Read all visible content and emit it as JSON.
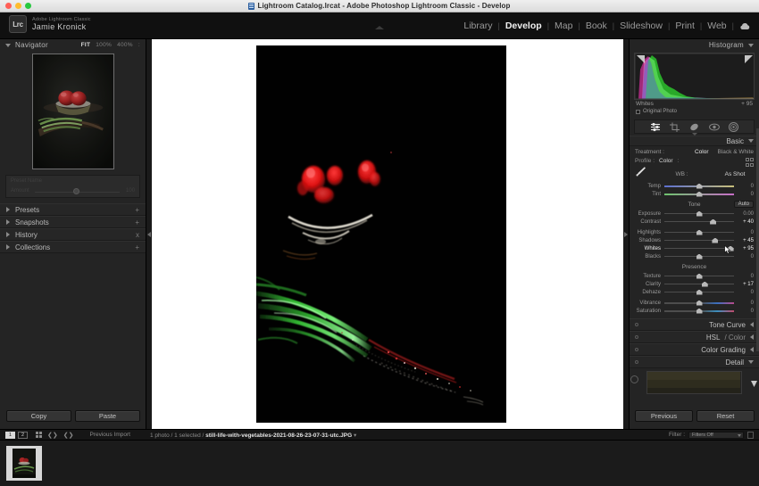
{
  "window": {
    "title": "Lightroom Catalog.lrcat - Adobe Photoshop Lightroom Classic - Develop",
    "doc_icon": "document-icon"
  },
  "brand": {
    "badge": "Lrc",
    "product": "Adobe Lightroom Classic",
    "user": "Jamie Kronick"
  },
  "modules": {
    "items": [
      {
        "label": "Library",
        "active": false
      },
      {
        "label": "Develop",
        "active": true
      },
      {
        "label": "Map",
        "active": false
      },
      {
        "label": "Book",
        "active": false
      },
      {
        "label": "Slideshow",
        "active": false
      },
      {
        "label": "Print",
        "active": false
      },
      {
        "label": "Web",
        "active": false
      }
    ],
    "separator": "|",
    "cloud_icon": "cloud-sync-icon"
  },
  "left_panel": {
    "navigator": {
      "title": "Navigator",
      "zoom_levels": [
        "FIT",
        "100%",
        "400%"
      ],
      "selected_zoom": "FIT",
      "more": ":"
    },
    "preset_preview": {
      "label": "Preset Name",
      "slider_label": "Amount",
      "value": "100"
    },
    "sections": [
      {
        "label": "Presets",
        "action": "+"
      },
      {
        "label": "Snapshots",
        "action": "+"
      },
      {
        "label": "History",
        "action": "x"
      },
      {
        "label": "Collections",
        "action": "+"
      }
    ],
    "buttons": {
      "copy": "Copy",
      "paste": "Paste"
    }
  },
  "right_panel": {
    "histogram": {
      "title": "Histogram",
      "readout_label": "Whites",
      "readout_value": "+ 95",
      "original_photo_label": "Original Photo",
      "original_photo_checked": false
    },
    "tools": [
      {
        "name": "adjustment-brush-icon",
        "active": true
      },
      {
        "name": "crop-overlay-icon",
        "active": false
      },
      {
        "name": "spot-removal-icon",
        "active": false
      },
      {
        "name": "red-eye-icon",
        "active": false
      },
      {
        "name": "radial-gradient-icon",
        "active": false
      }
    ],
    "basic": {
      "title": "Basic",
      "treatment_label": "Treatment :",
      "treatment_options": [
        "Color",
        "Black & White"
      ],
      "treatment_selected": "Color",
      "profile_label": "Profile :",
      "profile_value": "Color",
      "profile_more": ":",
      "browse_icon": "profile-browser-icon",
      "wb_label": "WB :",
      "wb_value": "As Shot",
      "eyedropper_icon": "white-balance-selector-icon",
      "wb_sliders": [
        {
          "label": "Temp",
          "value": "0",
          "pos": 50
        },
        {
          "label": "Tint",
          "value": "0",
          "pos": 50
        }
      ],
      "tone_title": "Tone",
      "auto_label": "Auto",
      "tone_sliders": [
        {
          "label": "Exposure",
          "value": "0.00",
          "pos": 50
        },
        {
          "label": "Contrast",
          "value": "+ 40",
          "pos": 70
        },
        {
          "label": "Highlights",
          "value": "0",
          "pos": 50
        },
        {
          "label": "Shadows",
          "value": "+ 45",
          "pos": 73
        },
        {
          "label": "Whites",
          "value": "+ 95",
          "pos": 95,
          "active": true
        },
        {
          "label": "Blacks",
          "value": "0",
          "pos": 50
        }
      ],
      "presence_title": "Presence",
      "presence_sliders": [
        {
          "label": "Texture",
          "value": "0",
          "pos": 50
        },
        {
          "label": "Clarity",
          "value": "+ 17",
          "pos": 58
        },
        {
          "label": "Dehaze",
          "value": "0",
          "pos": 50
        },
        {
          "label": "Vibrance",
          "value": "0",
          "pos": 50
        },
        {
          "label": "Saturation",
          "value": "0",
          "pos": 50
        }
      ]
    },
    "collapsed_sections": [
      {
        "label": "Tone Curve",
        "sub": "",
        "expanded": false
      },
      {
        "label": "HSL",
        "sub": " / Color",
        "expanded": false
      },
      {
        "label": "Color Grading",
        "sub": "",
        "expanded": false
      },
      {
        "label": "Detail",
        "sub": "",
        "expanded": true
      }
    ],
    "buttons": {
      "previous": "Previous",
      "reset": "Reset"
    }
  },
  "filmstrip_bar": {
    "page_badges": [
      "1",
      "2"
    ],
    "grid_icon": "grid-view-icon",
    "nav_back_icon": "filmstrip-back-icon",
    "nav_forward_icon": "filmstrip-forward-icon",
    "source": "Previous Import",
    "count_prefix": "1 photo / 1 selected / ",
    "filename": "still-life-with-vegetables-2021-08-26-23-07-31-utc.JPG",
    "filename_suffix": " ▾",
    "filter_label": "Filter :",
    "filter_value": "Filters Off",
    "lock_icon": "filter-lock-icon"
  },
  "colors": {
    "panel_bg": "#242424",
    "stage_bg": "#ffffff",
    "accent_text": "#f2f2f2",
    "slider_knob": "#b9b9b9",
    "tomato_red": "#d21f1f",
    "onion_green": "#3fd43f"
  }
}
